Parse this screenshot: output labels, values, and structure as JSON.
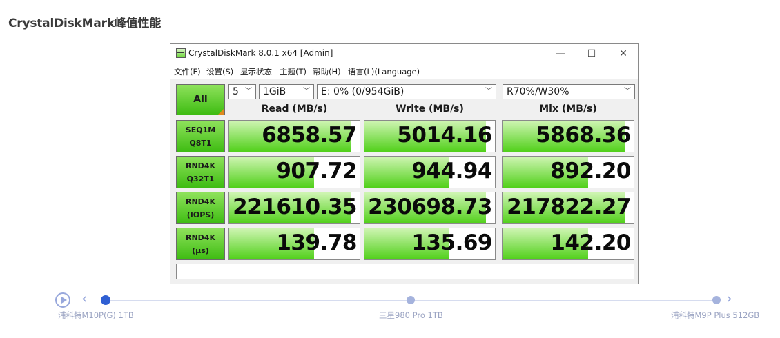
{
  "page": {
    "title": "CrystalDiskMark峰值性能"
  },
  "window": {
    "title": "CrystalDiskMark 8.0.1 x64 [Admin]",
    "controls": {
      "minimize": "—",
      "maximize": "☐",
      "close": "✕"
    }
  },
  "menu": {
    "items": [
      "文件(F)",
      "设置(S)",
      "显示状态",
      "主题(T)",
      "帮助(H)",
      "语言(L)(Language)"
    ]
  },
  "toolbar": {
    "all_label": "All",
    "count": "5",
    "size": "1GiB",
    "drive": "E: 0% (0/954GiB)",
    "mix_mode": "R70%/W30%"
  },
  "columns": {
    "read": "Read (MB/s)",
    "write": "Write (MB/s)",
    "mix": "Mix (MB/s)"
  },
  "rows": [
    {
      "line1": "SEQ1M",
      "line2": "Q8T1",
      "read": "6858.57",
      "write": "5014.16",
      "mix": "5868.36"
    },
    {
      "line1": "RND4K",
      "line2": "Q32T1",
      "read": "907.72",
      "write": "944.94",
      "mix": "892.20"
    },
    {
      "line1": "RND4K",
      "line2": "(IOPS)",
      "read": "221610.35",
      "write": "230698.73",
      "mix": "217822.27"
    },
    {
      "line1": "RND4K",
      "line2": "(μs)",
      "read": "139.78",
      "write": "135.69",
      "mix": "142.20"
    }
  ],
  "bar_fill_fraction": [
    [
      0.93,
      0.93,
      0.93
    ],
    [
      0.65,
      0.65,
      0.65
    ],
    [
      0.93,
      0.93,
      0.93
    ],
    [
      0.65,
      0.65,
      0.65
    ]
  ],
  "colors": {
    "accent_green": "#51d01a",
    "timeline_active": "#2f5fd3",
    "timeline_inactive": "#a5b3dd"
  },
  "timeline": {
    "items": [
      "浦科特M10P(G) 1TB",
      "三星980 Pro 1TB",
      "浦科特M9P Plus 512GB"
    ],
    "prev_icon": "chevron-left-icon",
    "next_icon": "chevron-right-icon",
    "play_icon": "play-icon"
  }
}
